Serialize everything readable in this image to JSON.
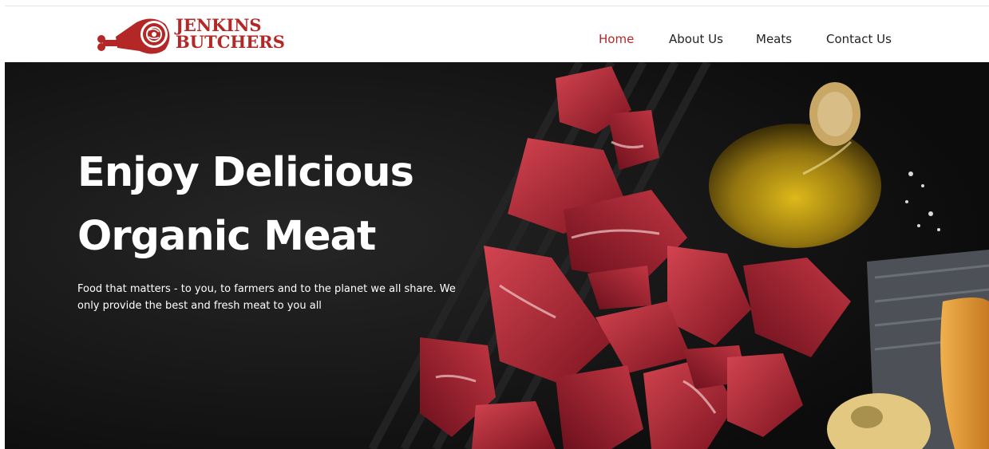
{
  "brand": {
    "line1": "JENKINS",
    "line2": "BUTCHERS",
    "color": "#b32826"
  },
  "nav": {
    "items": [
      {
        "label": "Home",
        "active": true
      },
      {
        "label": "About Us",
        "active": false
      },
      {
        "label": "Meats",
        "active": false
      },
      {
        "label": "Contact Us",
        "active": false
      }
    ],
    "active_color": "#b32826"
  },
  "hero": {
    "title_line1": "Enjoy Delicious",
    "title_line2": "Organic Meat",
    "description": "Food that matters - to you, to farmers and to the planet we all share. We only provide the best and fresh meat to you all"
  }
}
